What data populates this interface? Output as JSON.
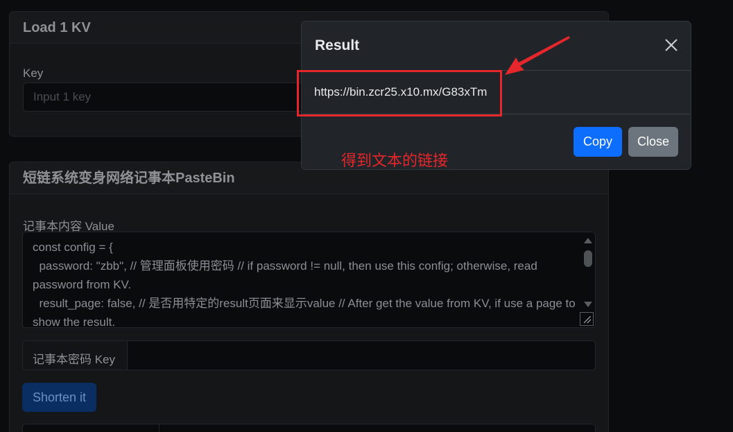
{
  "load_card": {
    "title": "Load 1 KV",
    "key_label": "Key",
    "key_placeholder": "Input 1 key"
  },
  "pastebin_card": {
    "title": "短链系统变身网络记事本PasteBin",
    "value_label": "记事本内容 Value",
    "value_text": "const config = {\n  password: \"zbb\", // 管理面板使用密码 // if password != null, then use this config; otherwise, read password from KV.\n  result_page: false, // 是否用特定的result页面来显示value // After get the value from KV, if use a page to show the result.",
    "key_addon": "记事本密码 Key",
    "key_value": "",
    "shorten_label": "Shorten it"
  },
  "modal": {
    "title": "Result",
    "result_link": "https://bin.zcr25.x10.mx/G83xTm",
    "copy_label": "Copy",
    "close_label": "Close"
  },
  "annotation": {
    "text": "得到文本的链接",
    "color": "#e5262a"
  },
  "colors": {
    "background": "#0b0c0d",
    "modal_bg": "#212529",
    "primary": "#0d6efd",
    "secondary": "#6c757d"
  }
}
